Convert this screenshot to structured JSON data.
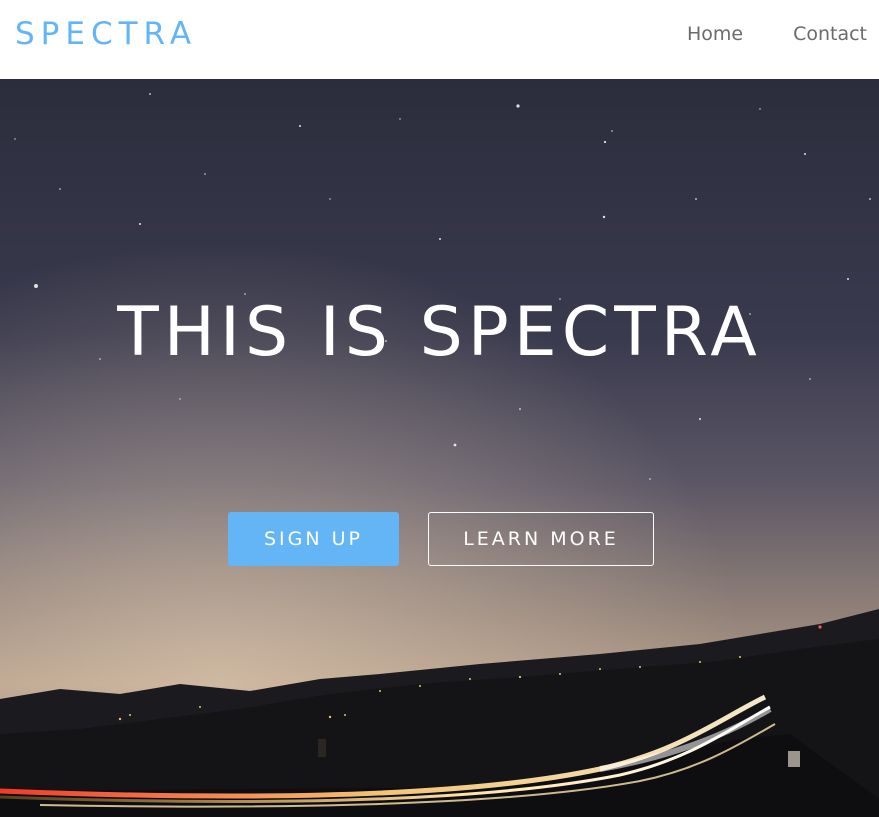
{
  "header": {
    "brand": "SPECTRA",
    "nav": [
      {
        "label": "Home"
      },
      {
        "label": "Contact"
      }
    ]
  },
  "hero": {
    "title": "THIS IS SPECTRA",
    "buttons": {
      "primary": "SIGN UP",
      "secondary": "LEARN MORE"
    }
  },
  "colors": {
    "accent": "#64b5f6",
    "nav_text": "#6b6b6b",
    "hero_text": "#ffffff"
  }
}
